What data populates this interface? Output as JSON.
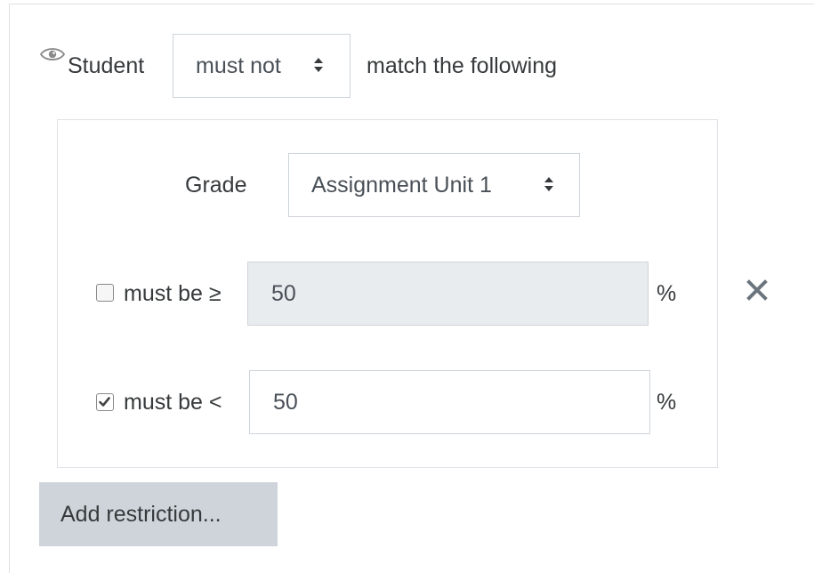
{
  "restriction_set": {
    "subject_label": "Student",
    "mode_select": {
      "selected": "must not"
    },
    "match_label": "match the following",
    "eye_icon": "eye-icon"
  },
  "grade_condition": {
    "grade_label": "Grade",
    "item_select": {
      "selected": "Assignment Unit 1"
    },
    "min": {
      "checked": false,
      "label": "must be ≥",
      "value": "50",
      "unit": "%"
    },
    "max": {
      "checked": true,
      "label": "must be <",
      "value": "50",
      "unit": "%"
    },
    "delete_icon": "close-icon"
  },
  "add_restriction_label": "Add restriction..."
}
